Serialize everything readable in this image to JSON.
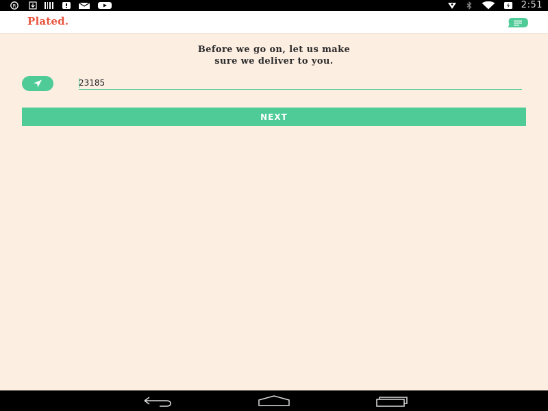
{
  "status_bar": {
    "left_icons": [
      "registered-icon",
      "download-icon",
      "barcode-icon",
      "notification-icon",
      "mail-check-icon",
      "youtube-icon"
    ],
    "right_icons": [
      "location-icon",
      "bluetooth-icon",
      "wifi-icon",
      "battery-icon"
    ],
    "time": "2:51"
  },
  "app_bar": {
    "logo": "Plated.",
    "chat_icon": "chat-menu-icon"
  },
  "main": {
    "headline_line1": "Before we go on, let us make",
    "headline_line2": "sure we deliver to you.",
    "locate_icon": "navigation-arrow-icon",
    "zip_value": "23185",
    "next_label": "NEXT"
  },
  "nav_bar": {
    "buttons": [
      "back-icon",
      "home-icon",
      "recents-icon"
    ]
  },
  "colors": {
    "background": "#fdeee2",
    "accent": "#4ecb97",
    "brand": "#e8553f",
    "text": "#2b2b2b"
  }
}
